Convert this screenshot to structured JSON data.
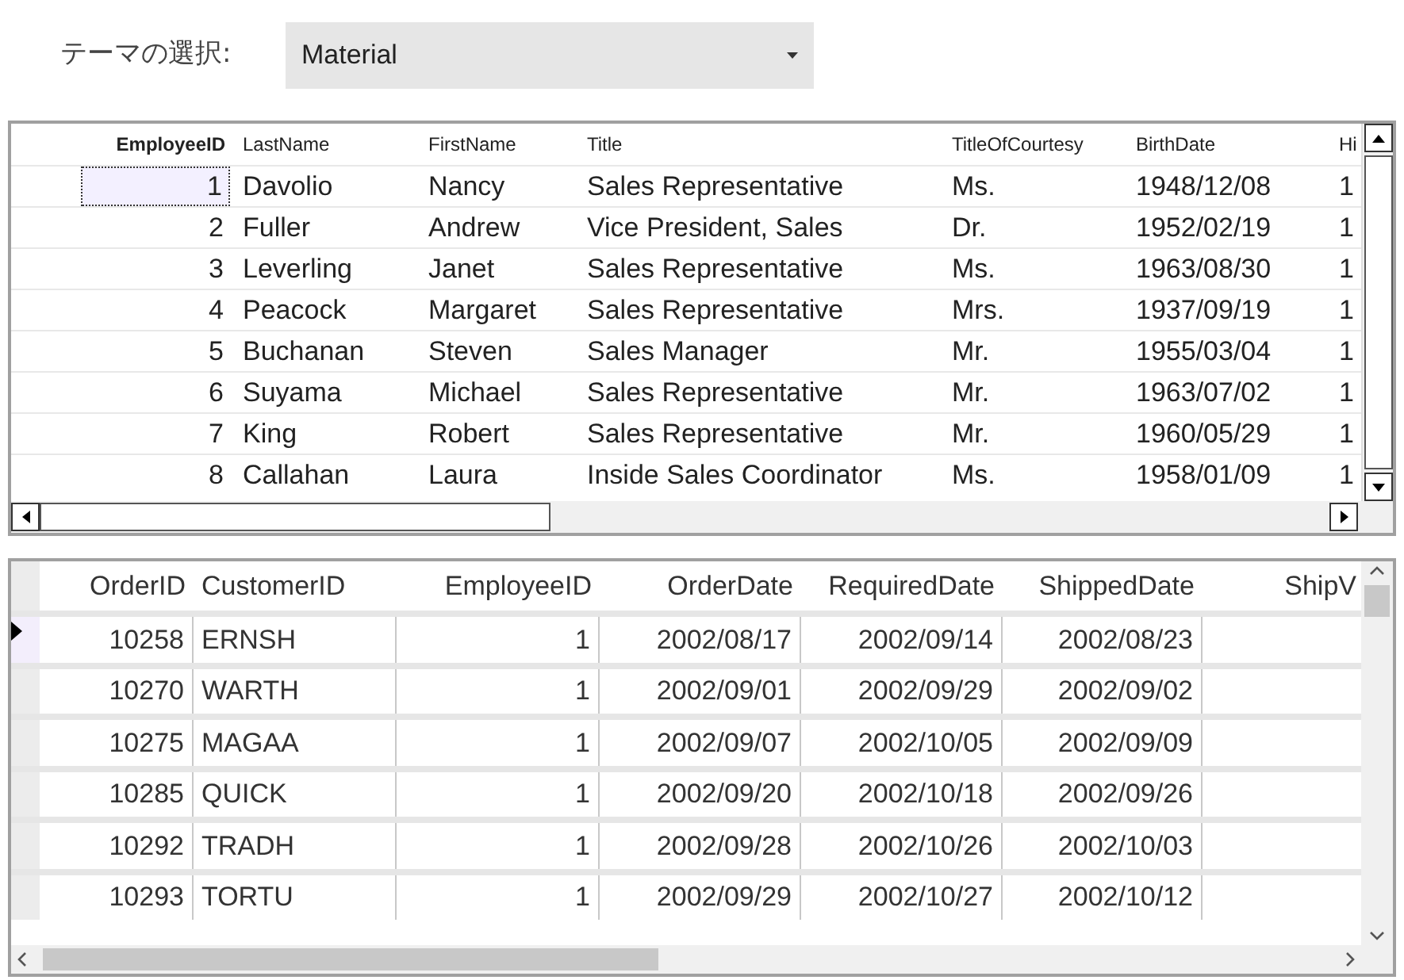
{
  "theme_selector": {
    "label": "テーマの選択:",
    "value": "Material"
  },
  "employees_grid": {
    "columns": [
      "EmployeeID",
      "LastName",
      "FirstName",
      "Title",
      "TitleOfCourtesy",
      "BirthDate",
      "Hi"
    ],
    "rows": [
      {
        "selected": true,
        "cells": [
          "1",
          "Davolio",
          "Nancy",
          "Sales Representative",
          "Ms.",
          "1948/12/08",
          "1"
        ]
      },
      {
        "selected": false,
        "cells": [
          "2",
          "Fuller",
          "Andrew",
          "Vice President, Sales",
          "Dr.",
          "1952/02/19",
          "1"
        ]
      },
      {
        "selected": false,
        "cells": [
          "3",
          "Leverling",
          "Janet",
          "Sales Representative",
          "Ms.",
          "1963/08/30",
          "1"
        ]
      },
      {
        "selected": false,
        "cells": [
          "4",
          "Peacock",
          "Margaret",
          "Sales Representative",
          "Mrs.",
          "1937/09/19",
          "1"
        ]
      },
      {
        "selected": false,
        "cells": [
          "5",
          "Buchanan",
          "Steven",
          "Sales Manager",
          "Mr.",
          "1955/03/04",
          "1"
        ]
      },
      {
        "selected": false,
        "cells": [
          "6",
          "Suyama",
          "Michael",
          "Sales Representative",
          "Mr.",
          "1963/07/02",
          "1"
        ]
      },
      {
        "selected": false,
        "cells": [
          "7",
          "King",
          "Robert",
          "Sales Representative",
          "Mr.",
          "1960/05/29",
          "1"
        ]
      },
      {
        "selected": false,
        "cells": [
          "8",
          "Callahan",
          "Laura",
          "Inside Sales Coordinator",
          "Ms.",
          "1958/01/09",
          "1"
        ]
      }
    ]
  },
  "orders_grid": {
    "columns": [
      "OrderID",
      "CustomerID",
      "EmployeeID",
      "OrderDate",
      "RequiredDate",
      "ShippedDate",
      "ShipV"
    ],
    "rows": [
      {
        "selected": true,
        "cells": [
          "10258",
          "ERNSH",
          "1",
          "2002/08/17",
          "2002/09/14",
          "2002/08/23"
        ]
      },
      {
        "selected": false,
        "cells": [
          "10270",
          "WARTH",
          "1",
          "2002/09/01",
          "2002/09/29",
          "2002/09/02"
        ]
      },
      {
        "selected": false,
        "cells": [
          "10275",
          "MAGAA",
          "1",
          "2002/09/07",
          "2002/10/05",
          "2002/09/09"
        ]
      },
      {
        "selected": false,
        "cells": [
          "10285",
          "QUICK",
          "1",
          "2002/09/20",
          "2002/10/18",
          "2002/09/26"
        ]
      },
      {
        "selected": false,
        "cells": [
          "10292",
          "TRADH",
          "1",
          "2002/09/28",
          "2002/10/26",
          "2002/10/03"
        ]
      },
      {
        "selected": false,
        "cells": [
          "10293",
          "TORTU",
          "1",
          "2002/09/29",
          "2002/10/27",
          "2002/10/12"
        ]
      }
    ]
  }
}
